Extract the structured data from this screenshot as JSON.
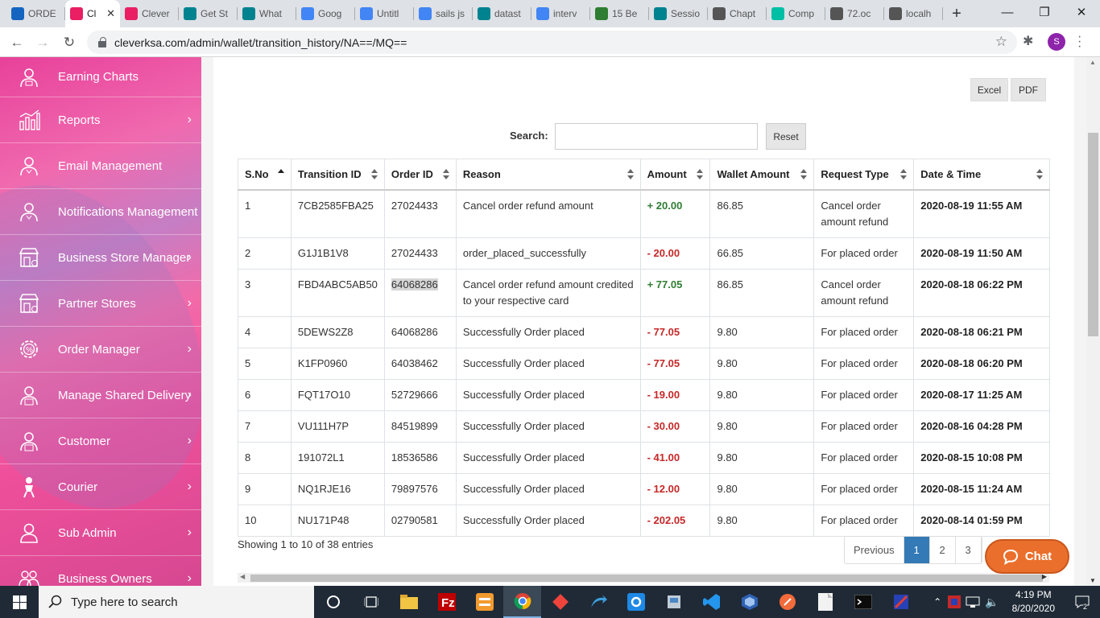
{
  "browser": {
    "tabs": [
      {
        "label": "ORDE",
        "icon_color": "#1565c0"
      },
      {
        "label": "Cl",
        "icon_color": "#e91e63",
        "active": true
      },
      {
        "label": "Clever",
        "icon_color": "#e91e63"
      },
      {
        "label": "Get St",
        "icon_color": "#00838f"
      },
      {
        "label": "What",
        "icon_color": "#00838f"
      },
      {
        "label": "Goog",
        "icon_color": "#4285f4"
      },
      {
        "label": "Untitl",
        "icon_color": "#4285f4"
      },
      {
        "label": "sails js",
        "icon_color": "#4285f4"
      },
      {
        "label": "datast",
        "icon_color": "#00838f"
      },
      {
        "label": "interv",
        "icon_color": "#4285f4"
      },
      {
        "label": "15 Be",
        "icon_color": "#2e7d32"
      },
      {
        "label": "Sessio",
        "icon_color": "#00838f"
      },
      {
        "label": "Chapt",
        "icon_color": "#555555"
      },
      {
        "label": "Comp",
        "icon_color": "#00bfa5"
      },
      {
        "label": "72.oc",
        "icon_color": "#555555"
      },
      {
        "label": "localh",
        "icon_color": "#555555"
      }
    ],
    "url": "cleverksa.com/admin/wallet/transition_history/NA==/MQ==",
    "profile_initial": "S"
  },
  "sidebar": {
    "items": [
      {
        "label": "Earning Charts",
        "icon": "person-chart-icon",
        "arrow": false
      },
      {
        "label": "Reports",
        "icon": "bar-chart-icon",
        "arrow": true
      },
      {
        "label": "Email Management",
        "icon": "person-icon",
        "arrow": false
      },
      {
        "label": "Notifications Management",
        "icon": "person-icon",
        "arrow": false
      },
      {
        "label": "Business Store Manager",
        "icon": "store-icon",
        "arrow": true
      },
      {
        "label": "Partner Stores",
        "icon": "store-icon",
        "arrow": true
      },
      {
        "label": "Order Manager",
        "icon": "gear-percent-icon",
        "arrow": true
      },
      {
        "label": "Manage Shared Delivery",
        "icon": "courier-icon",
        "arrow": true
      },
      {
        "label": "Customer",
        "icon": "courier-icon",
        "arrow": true
      },
      {
        "label": "Courier",
        "icon": "delivery-person-icon",
        "arrow": true
      },
      {
        "label": "Sub Admin",
        "icon": "user-icon",
        "arrow": true
      },
      {
        "label": "Business Owners",
        "icon": "group-icon",
        "arrow": true
      }
    ]
  },
  "toolbar": {
    "excel": "Excel",
    "pdf": "PDF",
    "search_label": "Search:",
    "search_value": "",
    "reset": "Reset"
  },
  "table": {
    "headers": [
      "S.No",
      "Transition ID",
      "Order ID",
      "Reason",
      "Amount",
      "Wallet Amount",
      "Request Type",
      "Date & Time"
    ],
    "rows": [
      {
        "sno": "1",
        "tid": "7CB2585FBA25",
        "oid": "27024433",
        "reason": "Cancel order refund amount",
        "amount": "+ 20.00",
        "sign": "pos",
        "wallet": "86.85",
        "type": "Cancel order amount refund",
        "dt": "2020-08-19 11:55 AM"
      },
      {
        "sno": "2",
        "tid": "G1J1B1V8",
        "oid": "27024433",
        "reason": "order_placed_successfully",
        "amount": "- 20.00",
        "sign": "neg",
        "wallet": "66.85",
        "type": "For placed order",
        "dt": "2020-08-19 11:50 AM"
      },
      {
        "sno": "3",
        "tid": "FBD4ABC5AB50",
        "oid": "64068286",
        "reason": "Cancel order refund amount credited to your respective card",
        "amount": "+ 77.05",
        "sign": "pos",
        "wallet": "86.85",
        "type": "Cancel order amount refund",
        "dt": "2020-08-18 06:22 PM"
      },
      {
        "sno": "4",
        "tid": "5DEWS2Z8",
        "oid": "64068286",
        "reason": "Successfully Order placed",
        "amount": "- 77.05",
        "sign": "neg",
        "wallet": "9.80",
        "type": "For placed order",
        "dt": "2020-08-18 06:21 PM"
      },
      {
        "sno": "5",
        "tid": "K1FP0960",
        "oid": "64038462",
        "reason": "Successfully Order placed",
        "amount": "- 77.05",
        "sign": "neg",
        "wallet": "9.80",
        "type": "For placed order",
        "dt": "2020-08-18 06:20 PM"
      },
      {
        "sno": "6",
        "tid": "FQT17O10",
        "oid": "52729666",
        "reason": "Successfully Order placed",
        "amount": "- 19.00",
        "sign": "neg",
        "wallet": "9.80",
        "type": "For placed order",
        "dt": "2020-08-17 11:25 AM"
      },
      {
        "sno": "7",
        "tid": "VU111H7P",
        "oid": "84519899",
        "reason": "Successfully Order placed",
        "amount": "- 30.00",
        "sign": "neg",
        "wallet": "9.80",
        "type": "For placed order",
        "dt": "2020-08-16 04:28 PM"
      },
      {
        "sno": "8",
        "tid": "191072L1",
        "oid": "18536586",
        "reason": "Successfully Order placed",
        "amount": "- 41.00",
        "sign": "neg",
        "wallet": "9.80",
        "type": "For placed order",
        "dt": "2020-08-15 10:08 PM"
      },
      {
        "sno": "9",
        "tid": "NQ1RJE16",
        "oid": "79897576",
        "reason": "Successfully Order placed",
        "amount": "- 12.00",
        "sign": "neg",
        "wallet": "9.80",
        "type": "For placed order",
        "dt": "2020-08-15 11:24 AM"
      },
      {
        "sno": "10",
        "tid": "NU171P48",
        "oid": "02790581",
        "reason": "Successfully Order placed",
        "amount": "- 202.05",
        "sign": "neg",
        "wallet": "9.80",
        "type": "For placed order",
        "dt": "2020-08-14 01:59 PM"
      }
    ]
  },
  "footer": {
    "info": "Showing 1 to 10 of 38 entries",
    "prev": "Previous",
    "pages": [
      "1",
      "2",
      "3"
    ],
    "chat": "Chat"
  },
  "taskbar": {
    "search_placeholder": "Type here to search",
    "time": "4:19 PM",
    "date": "8/20/2020",
    "notifications": "2"
  }
}
